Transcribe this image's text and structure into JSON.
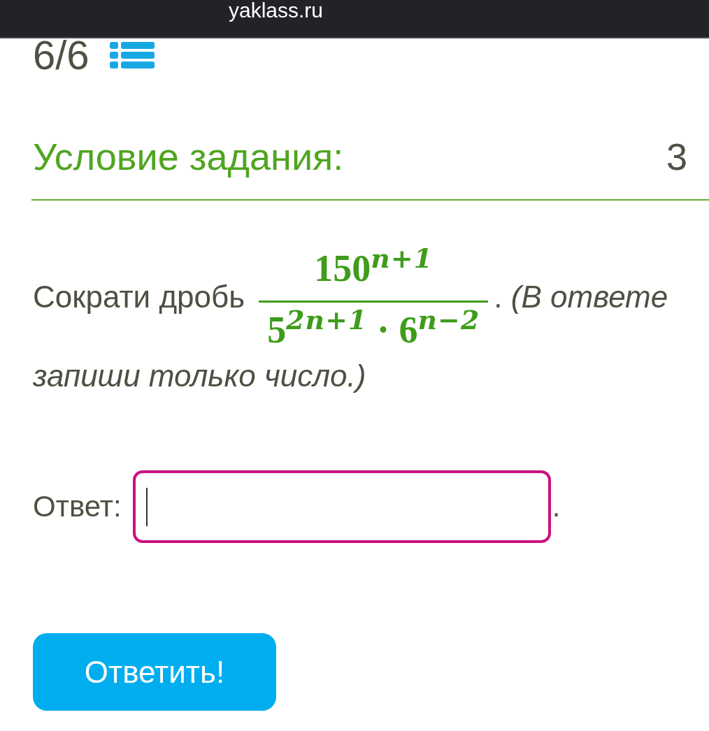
{
  "browser_bar": {
    "url": "yaklass.ru"
  },
  "progress": {
    "counter": "6/6"
  },
  "task": {
    "heading": "Условие задания:",
    "points": "3",
    "statement": {
      "lead": "Сократи дробь",
      "fraction": {
        "numerator": "150$^{n+1}$",
        "denominator": "5$^{2n+1}$ · 6$^{n−2}$"
      },
      "after_fraction": ". *(В ответе*",
      "continuation": "запиши только число.)"
    }
  },
  "answer": {
    "label": "Ответ:",
    "focused": true,
    "suffix": "."
  },
  "submit_button": {
    "label": "Ответить!"
  }
}
